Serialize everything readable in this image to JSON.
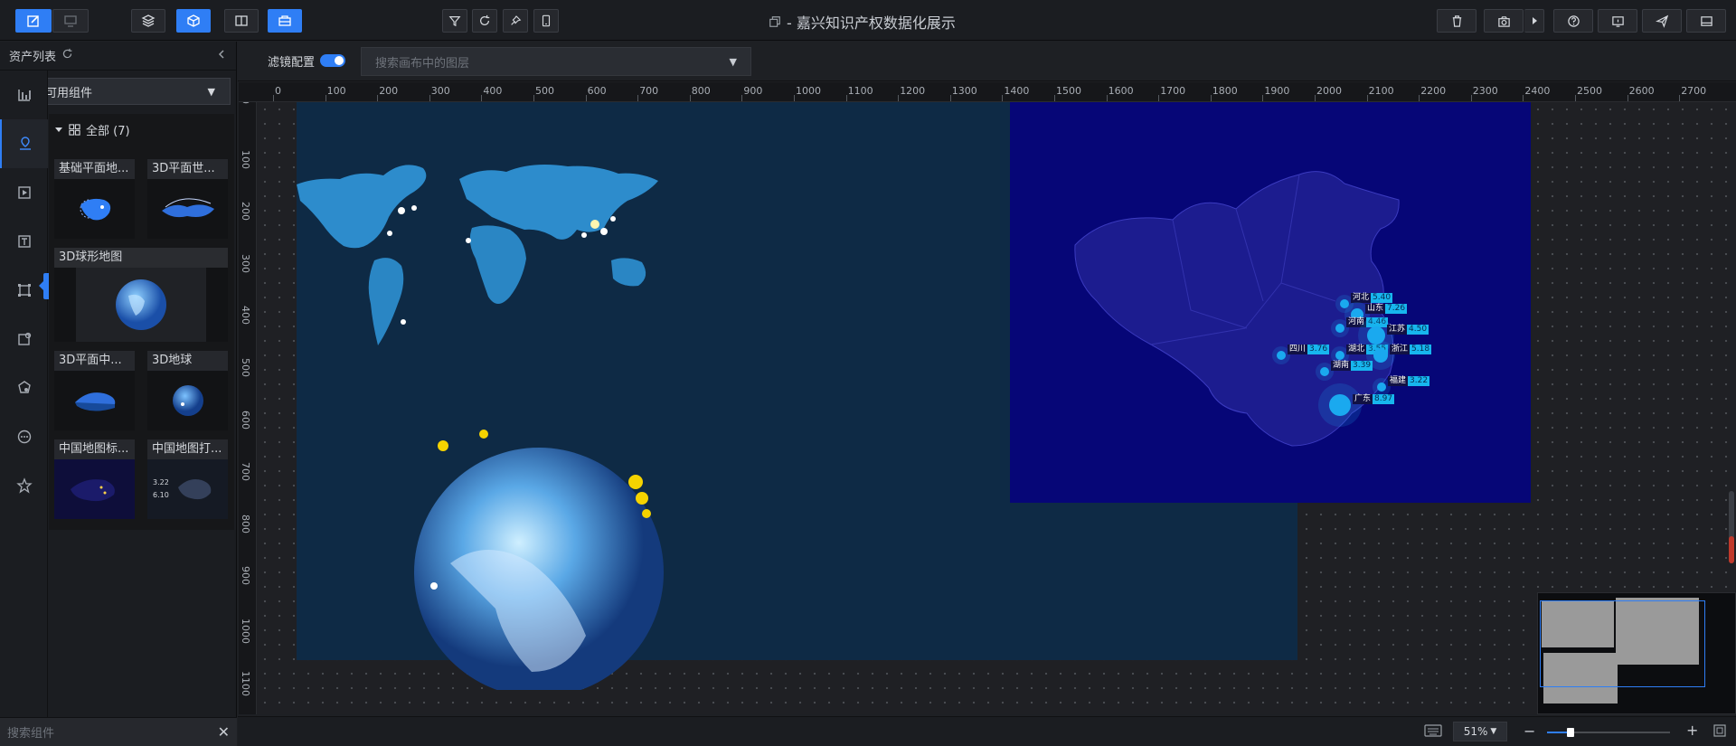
{
  "app": {
    "title": "- 嘉兴知识产权数据化展示"
  },
  "asset_panel": {
    "header": "资产列表",
    "category_select": "全部可用组件",
    "group": "全部 (7)",
    "cards": [
      {
        "title": "基础平面地...",
        "thumb": "china-map-thumb"
      },
      {
        "title": "3D平面世...",
        "thumb": "world-map-thumb"
      },
      {
        "title": "3D球形地图",
        "thumb": "globe-thumb"
      },
      {
        "title": "3D平面中...",
        "thumb": "china-3d-thumb"
      },
      {
        "title": "3D地球",
        "thumb": "earth-thumb"
      },
      {
        "title": "中国地图标...",
        "thumb": "china-marker-thumb"
      },
      {
        "title": "中国地图打...",
        "thumb": "china-flyline-thumb"
      }
    ],
    "card2_stat_a": "3.22",
    "card2_stat_b": "6.10",
    "rail_tooltip": "文字",
    "search_placeholder": "搜索组件"
  },
  "filter_bar": {
    "label": "滤镜配置",
    "layer_search_placeholder": "搜索画布中的图层"
  },
  "ruler": {
    "h_labels": [
      "0",
      "100",
      "200",
      "300",
      "400",
      "500",
      "600",
      "700",
      "800",
      "900",
      "1000",
      "1100",
      "1200",
      "1300",
      "1400",
      "1500",
      "1600",
      "1700",
      "1800",
      "1900",
      "2000",
      "2100",
      "2200",
      "2300",
      "2400",
      "2500",
      "2600",
      "2700"
    ],
    "v_labels": [
      "0",
      "100",
      "200",
      "300",
      "400",
      "500",
      "600",
      "700",
      "800",
      "900",
      "1000",
      "1100"
    ]
  },
  "china_map_labels": [
    {
      "province": "河北",
      "value": "5.40"
    },
    {
      "province": "山东",
      "value": "7.26"
    },
    {
      "province": "河南",
      "value": "4.46"
    },
    {
      "province": "江苏",
      "value": "4.50"
    },
    {
      "province": "四川",
      "value": "3.76"
    },
    {
      "province": "湖北",
      "value": "3.55"
    },
    {
      "province": "浙江",
      "value": "5.18"
    },
    {
      "province": "湖南",
      "value": "3.39"
    },
    {
      "province": "福建",
      "value": "3.22"
    },
    {
      "province": "广东",
      "value": "8.97"
    }
  ],
  "bottom_bar": {
    "zoom": "51%"
  },
  "colors": {
    "accent": "#2f7ef5",
    "screen_bg": "#0e2a45",
    "china_panel_bg": "#060677"
  }
}
